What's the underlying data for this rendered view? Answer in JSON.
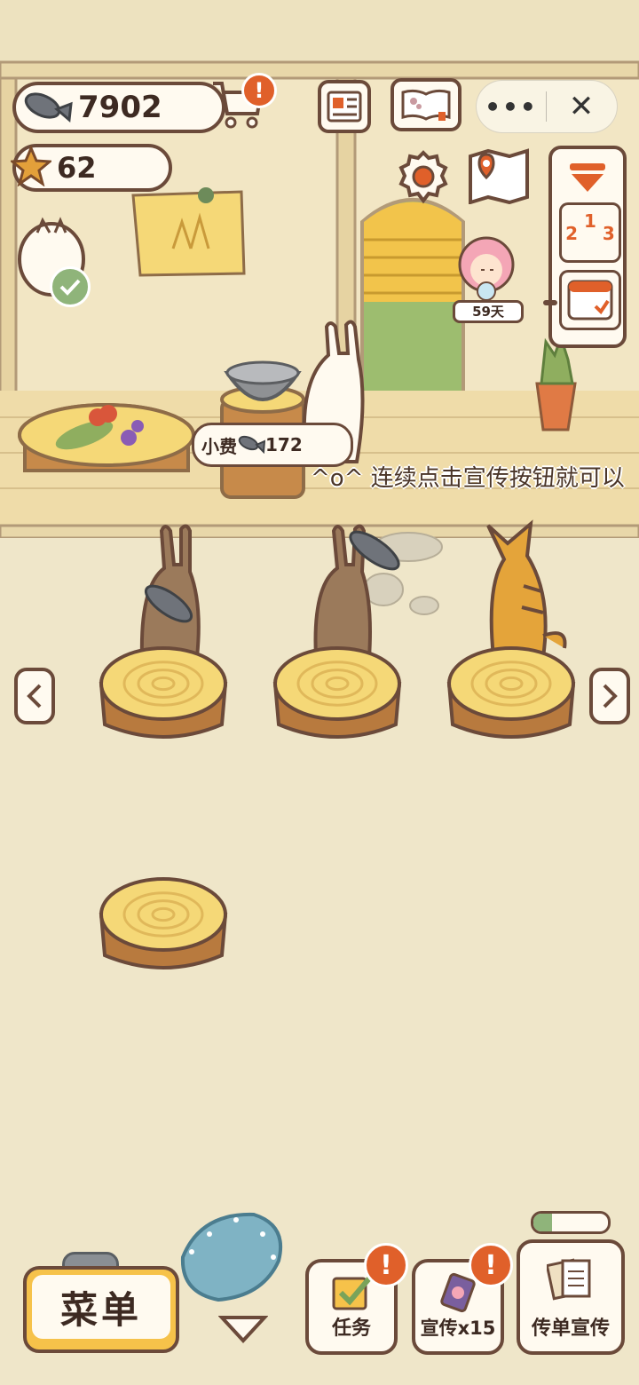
{
  "resources": {
    "fish_count": "7902",
    "star_count": "62"
  },
  "mini_program": {
    "more_label": "•••",
    "close_label": "✕"
  },
  "guest": {
    "days_label": "59天",
    "days_label_2": "1"
  },
  "tip_bubble": {
    "label": "小费",
    "amount": "172"
  },
  "marquee_text": "^o^ 连续点击宣传按钮就可以",
  "ranking_digits": [
    "1",
    "2",
    "3"
  ],
  "bottom_bar": {
    "menu_label": "菜单",
    "task_label": "任务",
    "promo_label": "宣传x15",
    "flyer_label": "传单宣传",
    "flyer_progress": 0.25,
    "alert_mark": "!"
  },
  "colors": {
    "outline": "#6b4a3a",
    "badge": "#e0602a",
    "menu_button": "#f6c24a"
  }
}
